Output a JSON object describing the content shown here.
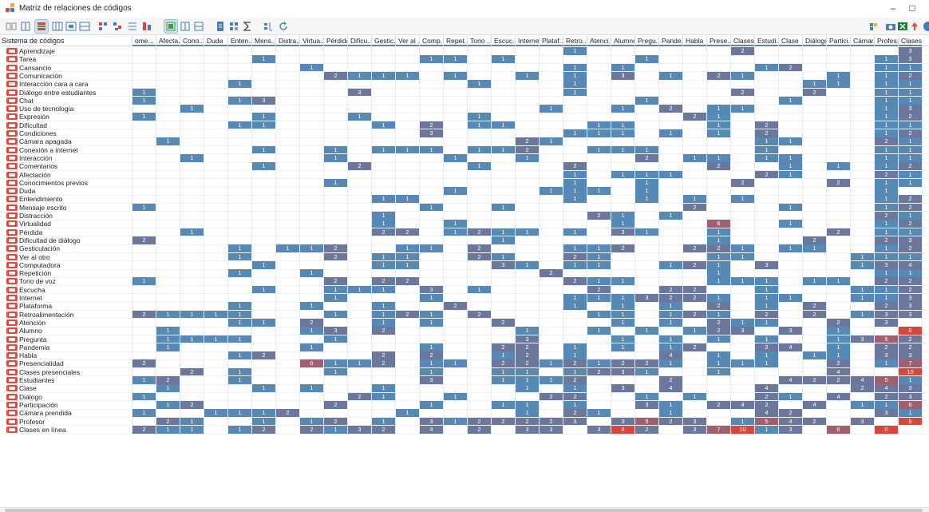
{
  "window": {
    "title": "Matriz de relaciones de códigos",
    "minimize_glyph": "–",
    "restore_glyph": "□"
  },
  "colors": {
    "low": "#5689b5",
    "mid": "#6b789b",
    "high": "#a06070",
    "max": "#d9473c"
  },
  "toolbar": {
    "icons": [
      "list-view-icon",
      "columns-icon",
      "highlight-icon",
      "grid-icon",
      "grid-alt-icon",
      "table-icon",
      "sort-icon",
      "code-a-icon",
      "code-b-icon",
      "code-c-icon",
      "squares-icon",
      "squares-alt-icon",
      "squares-third-icon",
      "doc-icon",
      "sum-icon",
      "sigma-icon",
      "chart-icon",
      "refresh-icon",
      "export-icon",
      "camera-icon",
      "excel-icon",
      "upload-icon",
      "info-icon"
    ]
  },
  "matrix": {
    "corner_label": "Sistema de códigos",
    "columns": [
      "ome...",
      "Afecta...",
      "Cono...",
      "Duda",
      "Enten...",
      "Mens...",
      "Distra...",
      "Virtua...",
      "Pérdida",
      "Dificu...",
      "Gestic...",
      "Ver al ...",
      "Comp...",
      "Repet...",
      "Tono ...",
      "Escuc...",
      "Internet",
      "Plataf...",
      "Retro...",
      "Atenci...",
      "Alumno",
      "Pregu...",
      "Pande...",
      "Habla",
      "Prese...",
      "Clases...",
      "Estudi...",
      "Clase",
      "Diálogo",
      "Partici...",
      "Cámar...",
      "Profes...",
      "Clases..."
    ],
    "rows": [
      {
        "label": "Aprendizaje",
        "cells": {
          "18": "1",
          "25": "2",
          "32": "3"
        }
      },
      {
        "label": "Tarea",
        "cells": {
          "5": "1",
          "12": "1",
          "13": "1",
          "15": "1",
          "21": "1",
          "31": "1",
          "32": "3"
        }
      },
      {
        "label": "Cansancio",
        "cells": {
          "7": "1",
          "18": "1",
          "20": "1",
          "26": "1",
          "27": "2",
          "31": "1",
          "32": "1"
        }
      },
      {
        "label": "Comunicación",
        "cells": {
          "8": "2",
          "9": "1",
          "10": "1",
          "11": "1",
          "13": "1",
          "16": "1",
          "18": "1",
          "20": "3",
          "22": "1",
          "24": "2",
          "25": "1",
          "29": "1",
          "31": "1",
          "32": "2"
        }
      },
      {
        "label": "Interacción cara a cara",
        "cells": {
          "4": "1",
          "14": "1",
          "18": "1",
          "28": "1",
          "29": "1",
          "31": "1",
          "32": "1"
        }
      },
      {
        "label": "Diálogo entre estudiantes",
        "cells": {
          "0": "1",
          "9": "3",
          "18": "1",
          "25": "2",
          "28": "2",
          "31": "1",
          "32": "1"
        }
      },
      {
        "label": "Chat",
        "cells": {
          "0": "1",
          "4": "1",
          "5": "3",
          "21": "1",
          "27": "1",
          "31": "1",
          "32": "1"
        }
      },
      {
        "label": "Uso de tecnología",
        "cells": {
          "2": "1",
          "17": "1",
          "20": "1",
          "22": "2",
          "24": "1",
          "25": "1",
          "31": "1",
          "32": "3"
        }
      },
      {
        "label": "Expresión",
        "cells": {
          "0": "1",
          "5": "1",
          "9": "1",
          "14": "1",
          "23": "2",
          "24": "1",
          "31": "1",
          "32": "2"
        }
      },
      {
        "label": "Dificultad",
        "cells": {
          "4": "1",
          "5": "1",
          "10": "1",
          "12": "2",
          "14": "1",
          "15": "1",
          "19": "1",
          "20": "1",
          "24": "1",
          "26": "2",
          "31": "1",
          "32": "1"
        }
      },
      {
        "label": "Condiciones",
        "cells": {
          "12": "3",
          "18": "1",
          "19": "1",
          "20": "1",
          "22": "1",
          "24": "1",
          "26": "2",
          "31": "1",
          "32": "2"
        }
      },
      {
        "label": "Cámara apagada",
        "cells": {
          "1": "1",
          "16": "2",
          "17": "1",
          "26": "1",
          "27": "1",
          "31": "2",
          "32": "1"
        }
      },
      {
        "label": "Conexión a internet",
        "cells": {
          "5": "1",
          "8": "1",
          "10": "1",
          "11": "1",
          "12": "1",
          "14": "1",
          "15": "1",
          "16": "2",
          "19": "1",
          "20": "1",
          "21": "1",
          "26": "1",
          "31": "1",
          "32": "1"
        }
      },
      {
        "label": "Interacción",
        "cells": {
          "2": "1",
          "8": "1",
          "13": "1",
          "16": "1",
          "21": "2",
          "23": "1",
          "24": "1",
          "26": "1",
          "27": "1",
          "31": "1",
          "32": "1"
        }
      },
      {
        "label": "Comentarios",
        "cells": {
          "5": "1",
          "9": "2",
          "14": "1",
          "18": "2",
          "24": "2",
          "27": "1",
          "29": "1",
          "31": "1",
          "32": "2"
        }
      },
      {
        "label": "Afectación",
        "cells": {
          "18": "1",
          "20": "1",
          "21": "1",
          "22": "1",
          "26": "2",
          "27": "1",
          "31": "2",
          "32": "1"
        }
      },
      {
        "label": "Conocimientos previos",
        "cells": {
          "8": "1",
          "18": "1",
          "21": "1",
          "25": "2",
          "29": "2",
          "31": "1",
          "32": "1"
        }
      },
      {
        "label": "Duda",
        "cells": {
          "13": "1",
          "17": "1",
          "18": "1",
          "19": "1",
          "21": "1",
          "31": "1"
        }
      },
      {
        "label": "Entendimiento",
        "cells": {
          "10": "1",
          "11": "1",
          "18": "1",
          "21": "1",
          "23": "1",
          "25": "1",
          "31": "1",
          "32": "2"
        }
      },
      {
        "label": "Mensaje escrito",
        "cells": {
          "0": "1",
          "12": "1",
          "15": "1",
          "23": "2",
          "27": "1",
          "31": "1",
          "32": "2"
        }
      },
      {
        "label": "Distracción",
        "cells": {
          "10": "1",
          "19": "2",
          "20": "1",
          "22": "1",
          "31": "2",
          "32": "1"
        }
      },
      {
        "label": "Virtualidad",
        "cells": {
          "10": "1",
          "13": "1",
          "20": "1",
          "24": "6",
          "27": "1",
          "31": "1",
          "32": "2"
        }
      },
      {
        "label": "Pérdida",
        "cells": {
          "2": "1",
          "10": "2",
          "11": "2",
          "13": "1",
          "14": "2",
          "15": "1",
          "16": "1",
          "18": "1",
          "20": "3",
          "21": "1",
          "24": "1",
          "29": "2",
          "31": "1",
          "32": "1"
        }
      },
      {
        "label": "Dificultad de diálogo",
        "cells": {
          "0": "2",
          "15": "1",
          "24": "1",
          "28": "2",
          "31": "2",
          "32": "3"
        }
      },
      {
        "label": "Gesticulación",
        "cells": {
          "4": "1",
          "6": "1",
          "7": "1",
          "8": "2",
          "11": "1",
          "12": "1",
          "14": "2",
          "18": "1",
          "19": "1",
          "20": "2",
          "23": "2",
          "24": "2",
          "25": "1",
          "27": "1",
          "28": "1",
          "31": "1",
          "32": "2"
        }
      },
      {
        "label": "Ver al otro",
        "cells": {
          "4": "1",
          "8": "2",
          "10": "1",
          "11": "1",
          "14": "2",
          "15": "1",
          "18": "2",
          "19": "1",
          "24": "1",
          "25": "1",
          "30": "1",
          "31": "1",
          "32": "1"
        }
      },
      {
        "label": "Computadora",
        "cells": {
          "5": "1",
          "10": "1",
          "11": "1",
          "15": "3",
          "16": "1",
          "18": "1",
          "19": "1",
          "22": "1",
          "23": "2",
          "24": "1",
          "26": "3",
          "30": "1",
          "31": "3",
          "32": "4"
        }
      },
      {
        "label": "Repetición",
        "cells": {
          "4": "1",
          "7": "1",
          "17": "2",
          "24": "1",
          "31": "1",
          "32": "1"
        }
      },
      {
        "label": "Tono de voz",
        "cells": {
          "0": "1",
          "8": "2",
          "10": "2",
          "11": "2",
          "18": "2",
          "19": "1",
          "20": "1",
          "24": "1",
          "25": "1",
          "26": "1",
          "28": "1",
          "29": "1",
          "31": "2",
          "32": "2"
        }
      },
      {
        "label": "Escucha",
        "cells": {
          "5": "1",
          "8": "1",
          "9": "1",
          "10": "1",
          "12": "3",
          "14": "1",
          "19": "2",
          "22": "2",
          "23": "2",
          "26": "1",
          "30": "1",
          "31": "1",
          "32": "2"
        }
      },
      {
        "label": "Internet",
        "cells": {
          "8": "1",
          "12": "1",
          "18": "1",
          "19": "1",
          "20": "1",
          "21": "3",
          "22": "2",
          "23": "2",
          "24": "1",
          "26": "1",
          "27": "1",
          "30": "1",
          "31": "1",
          "32": "3"
        }
      },
      {
        "label": "Plataforma",
        "cells": {
          "4": "1",
          "7": "1",
          "10": "1",
          "13": "2",
          "18": "1",
          "20": "1",
          "22": "1",
          "24": "2",
          "26": "1",
          "28": "2",
          "31": "2",
          "32": "3"
        }
      },
      {
        "label": "Retroalimentación",
        "cells": {
          "0": "2",
          "1": "1",
          "2": "1",
          "3": "1",
          "4": "1",
          "8": "1",
          "10": "1",
          "11": "2",
          "12": "1",
          "14": "2",
          "19": "1",
          "20": "1",
          "22": "1",
          "23": "2",
          "24": "1",
          "26": "2",
          "28": "2",
          "30": "1",
          "31": "3",
          "32": "3"
        }
      },
      {
        "label": "Atención",
        "cells": {
          "4": "1",
          "5": "1",
          "7": "2",
          "10": "1",
          "12": "1",
          "15": "2",
          "20": "1",
          "22": "1",
          "24": "2",
          "25": "1",
          "26": "1",
          "29": "2",
          "31": "3"
        }
      },
      {
        "label": "Alumno",
        "cells": {
          "1": "1",
          "7": "1",
          "8": "3",
          "10": "2",
          "16": "1",
          "19": "1",
          "21": "1",
          "23": "1",
          "24": "2",
          "25": "3",
          "27": "3",
          "29": "1",
          "32": "8"
        }
      },
      {
        "label": "Pregunta",
        "cells": {
          "1": "1",
          "2": "1",
          "3": "1",
          "4": "1",
          "8": "1",
          "16": "3",
          "20": "1",
          "22": "1",
          "24": "1",
          "26": "1",
          "29": "1",
          "30": "3",
          "31": "5",
          "32": "2"
        }
      },
      {
        "label": "Pandemia",
        "cells": {
          "1": "1",
          "7": "1",
          "12": "1",
          "15": "2",
          "16": "2",
          "18": "1",
          "20": "1",
          "22": "1",
          "23": "2",
          "26": "2",
          "27": "4",
          "29": "1",
          "31": "2",
          "32": "2"
        }
      },
      {
        "label": "Habla",
        "cells": {
          "4": "1",
          "5": "2",
          "10": "2",
          "12": "2",
          "15": "1",
          "16": "2",
          "18": "1",
          "22": "4",
          "24": "1",
          "26": "1",
          "28": "1",
          "29": "1",
          "31": "3",
          "32": "3"
        }
      },
      {
        "label": "Presencialidad",
        "cells": {
          "0": "2",
          "7": "6",
          "8": "1",
          "9": "1",
          "10": "2",
          "12": "1",
          "13": "1",
          "15": "2",
          "16": "2",
          "17": "1",
          "18": "2",
          "19": "1",
          "20": "2",
          "21": "2",
          "22": "1",
          "24": "1",
          "25": "1",
          "26": "1",
          "29": "2",
          "31": "1",
          "32": "7"
        }
      },
      {
        "label": "Clases presenciales",
        "cells": {
          "2": "2",
          "4": "1",
          "8": "1",
          "12": "1",
          "15": "1",
          "16": "1",
          "18": "1",
          "19": "2",
          "20": "3",
          "21": "1",
          "24": "1",
          "29": "4",
          "32": "10"
        }
      },
      {
        "label": "Estudiantes",
        "cells": {
          "0": "1",
          "1": "2",
          "4": "1",
          "12": "3",
          "15": "1",
          "16": "1",
          "17": "1",
          "18": "2",
          "22": "2",
          "27": "4",
          "28": "2",
          "29": "2",
          "30": "4",
          "31": "5",
          "32": "1"
        }
      },
      {
        "label": "Clase",
        "cells": {
          "1": "1",
          "5": "1",
          "7": "1",
          "10": "1",
          "16": "1",
          "18": "1",
          "20": "3",
          "22": "4",
          "26": "4",
          "30": "2",
          "31": "4",
          "32": "3"
        }
      },
      {
        "label": "Diálogo",
        "cells": {
          "0": "1",
          "9": "2",
          "10": "1",
          "13": "1",
          "17": "2",
          "18": "2",
          "21": "1",
          "23": "1",
          "26": "2",
          "27": "1",
          "29": "4",
          "31": "2",
          "32": "3"
        }
      },
      {
        "label": "Participación",
        "cells": {
          "1": "1",
          "2": "2",
          "8": "2",
          "12": "1",
          "15": "1",
          "16": "1",
          "18": "1",
          "21": "3",
          "22": "1",
          "24": "2",
          "25": "4",
          "26": "2",
          "28": "4",
          "30": "1",
          "31": "1",
          "32": "6"
        }
      },
      {
        "label": "Cámara prendida",
        "cells": {
          "0": "1",
          "3": "1",
          "4": "1",
          "5": "1",
          "6": "2",
          "11": "1",
          "16": "1",
          "18": "2",
          "19": "1",
          "22": "1",
          "26": "4",
          "27": "2",
          "31": "3",
          "32": "1"
        }
      },
      {
        "label": "Profesor",
        "cells": {
          "1": "2",
          "2": "1",
          "5": "1",
          "7": "1",
          "8": "2",
          "10": "1",
          "12": "3",
          "13": "1",
          "14": "2",
          "15": "2",
          "16": "2",
          "17": "2",
          "18": "3",
          "20": "3",
          "21": "5",
          "22": "2",
          "23": "3",
          "25": "1",
          "26": "5",
          "27": "4",
          "28": "2",
          "30": "3",
          "32": "8"
        }
      },
      {
        "label": "Clases en línea",
        "cells": {
          "0": "2",
          "1": "1",
          "2": "1",
          "4": "1",
          "5": "2",
          "7": "2",
          "8": "1",
          "9": "3",
          "10": "2",
          "12": "4",
          "14": "2",
          "16": "3",
          "17": "3",
          "19": "3",
          "20": "8",
          "21": "2",
          "23": "3",
          "24": "7",
          "25": "10",
          "26": "1",
          "27": "3",
          "29": "6",
          "31": "8"
        }
      }
    ]
  }
}
